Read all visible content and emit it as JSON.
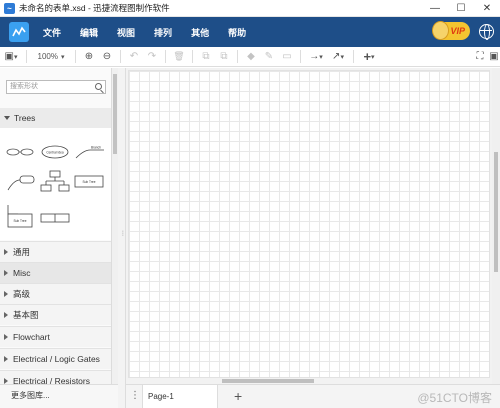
{
  "window": {
    "title": "未命名的表单.xsd - 迅捷流程图制作软件",
    "minimize": "—",
    "maximize": "☐",
    "close": "✕"
  },
  "menu": {
    "items": [
      "文件",
      "编辑",
      "视图",
      "排列",
      "其他",
      "帮助"
    ],
    "vip_label": "VIP"
  },
  "toolbar": {
    "zoom": "100%",
    "zoom_in": "⊕",
    "zoom_out": "⊖",
    "undo": "↶",
    "redo": "↷",
    "delete": "🗑",
    "to_front": "⧉",
    "to_back": "⧉",
    "fill": "◆",
    "line_color": "✎",
    "shadow": "▭",
    "connection": "→",
    "waypoint": "↗",
    "insert": "+",
    "fullscreen": "⛶",
    "page_view": "▣",
    "dropdown": "▾"
  },
  "sidebar": {
    "search_placeholder": "搜索形状",
    "trees_label": "Trees",
    "shape_labels": [
      "Central Idea",
      "Branch",
      "Sub Tree",
      "Sub Tree"
    ],
    "categories": [
      "通用",
      "Misc",
      "高级",
      "基本图",
      "Flowchart",
      "Electrical / Logic Gates",
      "Electrical / Resistors"
    ],
    "more_label": "更多图库..."
  },
  "pages": {
    "menu_glyph": "⋮",
    "current": "Page-1",
    "add": "+"
  },
  "watermark": "@51CTO博客",
  "colors": {
    "menubar": "#1e4e88",
    "accent": "#2e7bd6",
    "vip": "#f4c430"
  }
}
